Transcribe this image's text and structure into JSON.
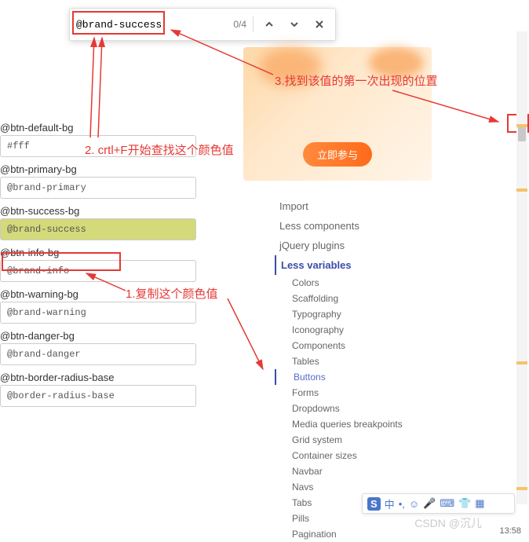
{
  "find": {
    "query": "@brand-success",
    "count": "0/4"
  },
  "banner": {
    "cta": "立即参与"
  },
  "annotations": {
    "step1": "1.复制这个颜色值",
    "step2": "2. crtl+F开始查找这个颜色值",
    "step3": "3.找到该值的第一次出现的位置"
  },
  "fields": [
    {
      "label": "@btn-default-bg",
      "value": "#fff"
    },
    {
      "label": "@btn-primary-bg",
      "value": "@brand-primary"
    },
    {
      "label": "@btn-success-bg",
      "value": "@brand-success"
    },
    {
      "label": "@btn-info-bg",
      "value": "@brand-info"
    },
    {
      "label": "@btn-warning-bg",
      "value": "@brand-warning"
    },
    {
      "label": "@btn-danger-bg",
      "value": "@brand-danger"
    },
    {
      "label": "@btn-border-radius-base",
      "value": "@border-radius-base"
    }
  ],
  "nav": {
    "main": [
      "Import",
      "Less components",
      "jQuery plugins",
      "Less variables"
    ],
    "sub": [
      "Colors",
      "Scaffolding",
      "Typography",
      "Iconography",
      "Components",
      "Tables",
      "Buttons",
      "Forms",
      "Dropdowns",
      "Media queries breakpoints",
      "Grid system",
      "Container sizes",
      "Navbar",
      "Navs",
      "Tabs",
      "Pills",
      "Pagination"
    ]
  },
  "watermark": "CSDN @沉儿",
  "clock": "13:58"
}
